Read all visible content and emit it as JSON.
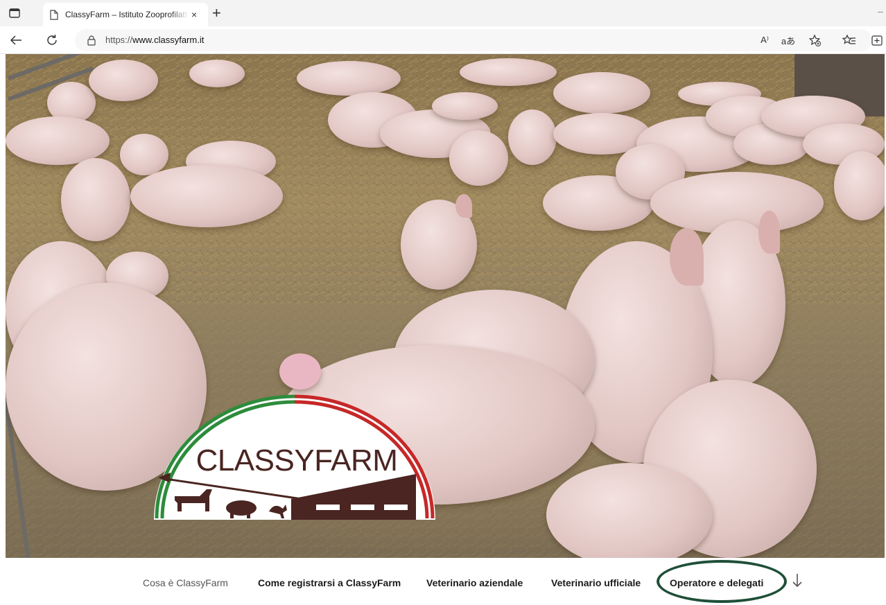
{
  "browser": {
    "tab": {
      "title": "ClassyFarm – Istituto Zooprofilatt",
      "close_icon": "×"
    },
    "new_tab_icon": "+",
    "url_prefix": "https://",
    "url_domain": "www.classyfarm.it",
    "toolbar": {
      "read_aloud_label": "A⁾",
      "translate_label": "aあ"
    }
  },
  "logo": {
    "text": "CLASSYFARM",
    "colors": {
      "green": "#2d8c3c",
      "white": "#ffffff",
      "red": "#c62828",
      "brown": "#4a2521"
    }
  },
  "site_nav": {
    "items": [
      {
        "label": "Cosa è ClassyFarm",
        "active": false
      },
      {
        "label": "Come registrarsi a ClassyFarm",
        "active": true
      },
      {
        "label": "Veterinario aziendale",
        "active": true
      },
      {
        "label": "Veterinario ufficiale",
        "active": true
      },
      {
        "label": "Operatore e delegati",
        "active": true,
        "highlighted": true
      }
    ],
    "more_icon": "arrow-down-icon"
  },
  "accent": {
    "highlight_ring": "#1f4f38"
  }
}
